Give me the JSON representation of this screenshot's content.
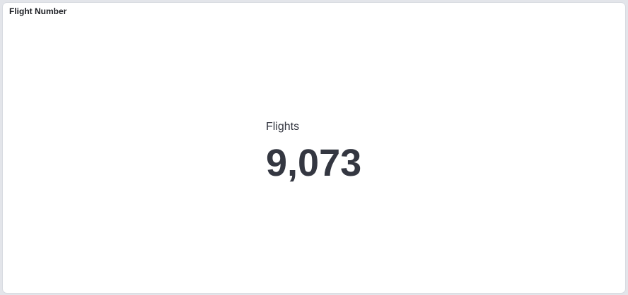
{
  "panel": {
    "title": "Flight Number"
  },
  "metric": {
    "label": "Flights",
    "value": "9,073"
  }
}
